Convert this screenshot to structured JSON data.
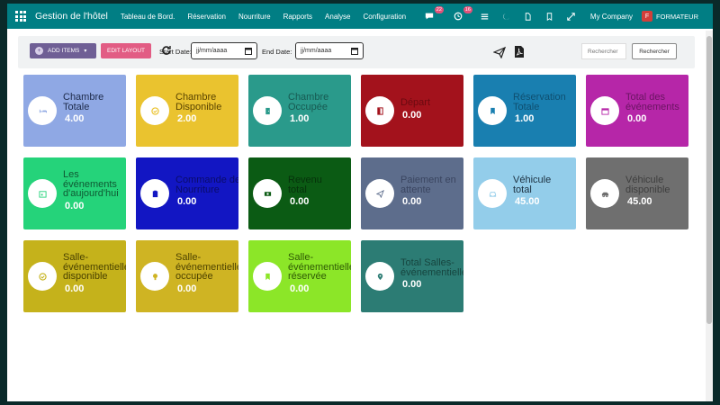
{
  "navbar": {
    "brand": "Gestion de l'hôtel",
    "menu": [
      "Tableau de Bord.",
      "Réservation",
      "Nourriture",
      "Rapports",
      "Analyse",
      "Configuration"
    ],
    "chat_badge": "22",
    "activity_badge": "16",
    "company": "My Company",
    "user_initial": "F",
    "user": "FORMATEUR",
    "bg_color": "#017e84"
  },
  "toolbar": {
    "add_items": "ADD ITEMS",
    "edit_layout": "EDIT LAYOUT",
    "start_date_label": "Start Date:",
    "start_date_placeholder": "jj/mm/aaaa",
    "end_date_label": "End Date:",
    "end_date_placeholder": "jj/mm/aaaa",
    "search_placeholder": "Rechercher",
    "search_button": "Rechercher"
  },
  "cards": [
    {
      "title": [
        "Chambre",
        "Totale"
      ],
      "value": "4.00",
      "color": "#8fa8e4",
      "icon": "bed-icon"
    },
    {
      "title": [
        "Chambre",
        "Disponible"
      ],
      "value": "2.00",
      "color": "#eac32f",
      "icon": "check-circle-icon"
    },
    {
      "title": [
        "Chambre",
        "Occupée"
      ],
      "value": "1.00",
      "color": "#2a9a8b",
      "icon": "door-icon"
    },
    {
      "title": [
        "Départ"
      ],
      "value": "0.00",
      "color": "#a3121c",
      "icon": "door-open-icon"
    },
    {
      "title": [
        "Réservation",
        "Totale"
      ],
      "value": "1.00",
      "color": "#197fb0",
      "icon": "bookmark-icon"
    },
    {
      "title": [
        "Total des",
        "événements"
      ],
      "value": "0.00",
      "color": "#b626a8",
      "icon": "calendar-icon"
    },
    {
      "title": [
        "Les",
        "événements",
        "d'aujourd'hui"
      ],
      "value": "0.00",
      "color": "#25d37a",
      "icon": "calendar-day-icon"
    },
    {
      "title": [
        "Commande de",
        "Nourriture"
      ],
      "value": "0.00",
      "color": "#1216c3",
      "icon": "clipboard-icon"
    },
    {
      "title": [
        "Revenu",
        "total"
      ],
      "value": "0.00",
      "color": "#0b5b14",
      "icon": "money-icon"
    },
    {
      "title": [
        "Paiement en",
        "attente"
      ],
      "value": "0.00",
      "color": "#5d6d8c",
      "icon": "send-icon"
    },
    {
      "title": [
        "Véhicule",
        "total"
      ],
      "value": "45.00",
      "color": "#93cdea",
      "icon": "car-icon"
    },
    {
      "title": [
        "Véhicule",
        "disponible"
      ],
      "value": "45.00",
      "color": "#6f6f6f",
      "icon": "car-side-icon"
    },
    {
      "title": [
        "Salle-",
        "événementielle",
        "disponible"
      ],
      "value": "0.00",
      "color": "#c5b21b",
      "icon": "check-icon"
    },
    {
      "title": [
        "Salle-",
        "événementielle",
        "occupée"
      ],
      "value": "0.00",
      "color": "#cfb423",
      "icon": "lightbulb-icon"
    },
    {
      "title": [
        "Salle-",
        "événementielle",
        "réservée"
      ],
      "value": "0.00",
      "color": "#8ce628",
      "icon": "bookmark-icon"
    },
    {
      "title": [
        "Total Salles-",
        "événementielles"
      ],
      "value": "0.00",
      "color": "#2c7c74",
      "icon": "map-marker-icon"
    }
  ]
}
